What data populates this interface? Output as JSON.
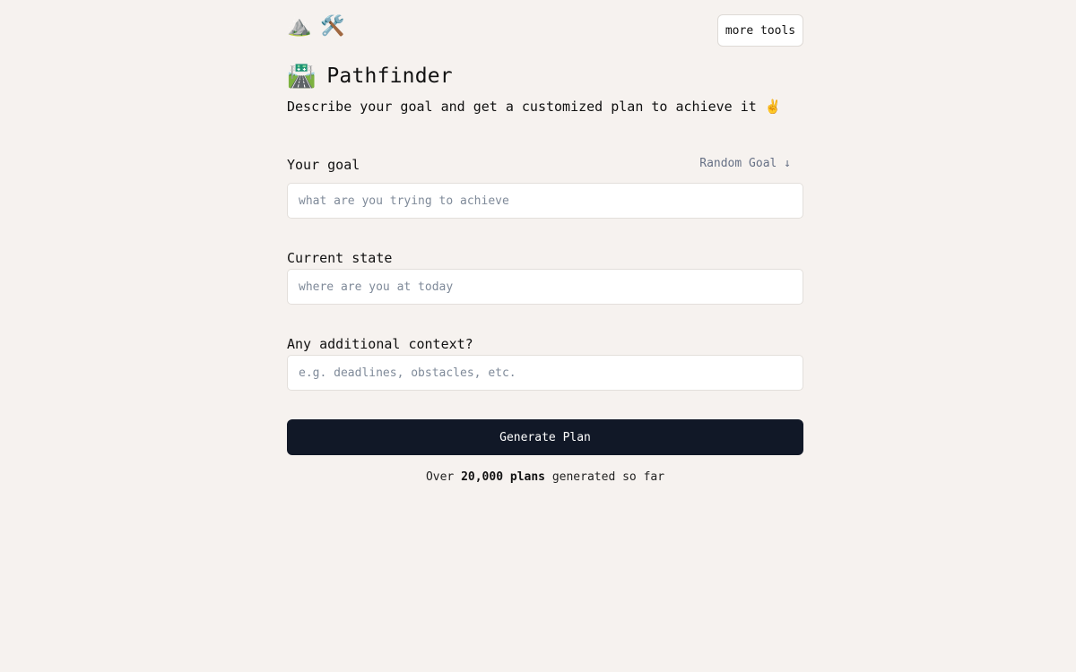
{
  "header": {
    "icons": [
      "⛰️",
      "🛠️"
    ],
    "icon_names": [
      "mountain-icon",
      "tools-icon"
    ],
    "more_tools_label": "more tools"
  },
  "app": {
    "title_emoji": "🛣️",
    "title": "Pathfinder",
    "subtitle": "Describe your goal and get a customized plan to achieve it ✌️"
  },
  "form": {
    "goal": {
      "label": "Your goal",
      "random_label": "Random Goal ↓",
      "placeholder": "what are you trying to achieve",
      "value": ""
    },
    "current_state": {
      "label": "Current state",
      "placeholder": "where are you at today",
      "value": ""
    },
    "context": {
      "label": "Any additional context?",
      "placeholder": "e.g. deadlines, obstacles, etc.",
      "value": ""
    },
    "submit_label": "Generate Plan"
  },
  "stats": {
    "prefix": "Over",
    "count": "20,000 plans",
    "suffix": "generated so far"
  },
  "colors": {
    "background": "#f6f2ef",
    "button": "#111827",
    "muted": "#667085"
  }
}
